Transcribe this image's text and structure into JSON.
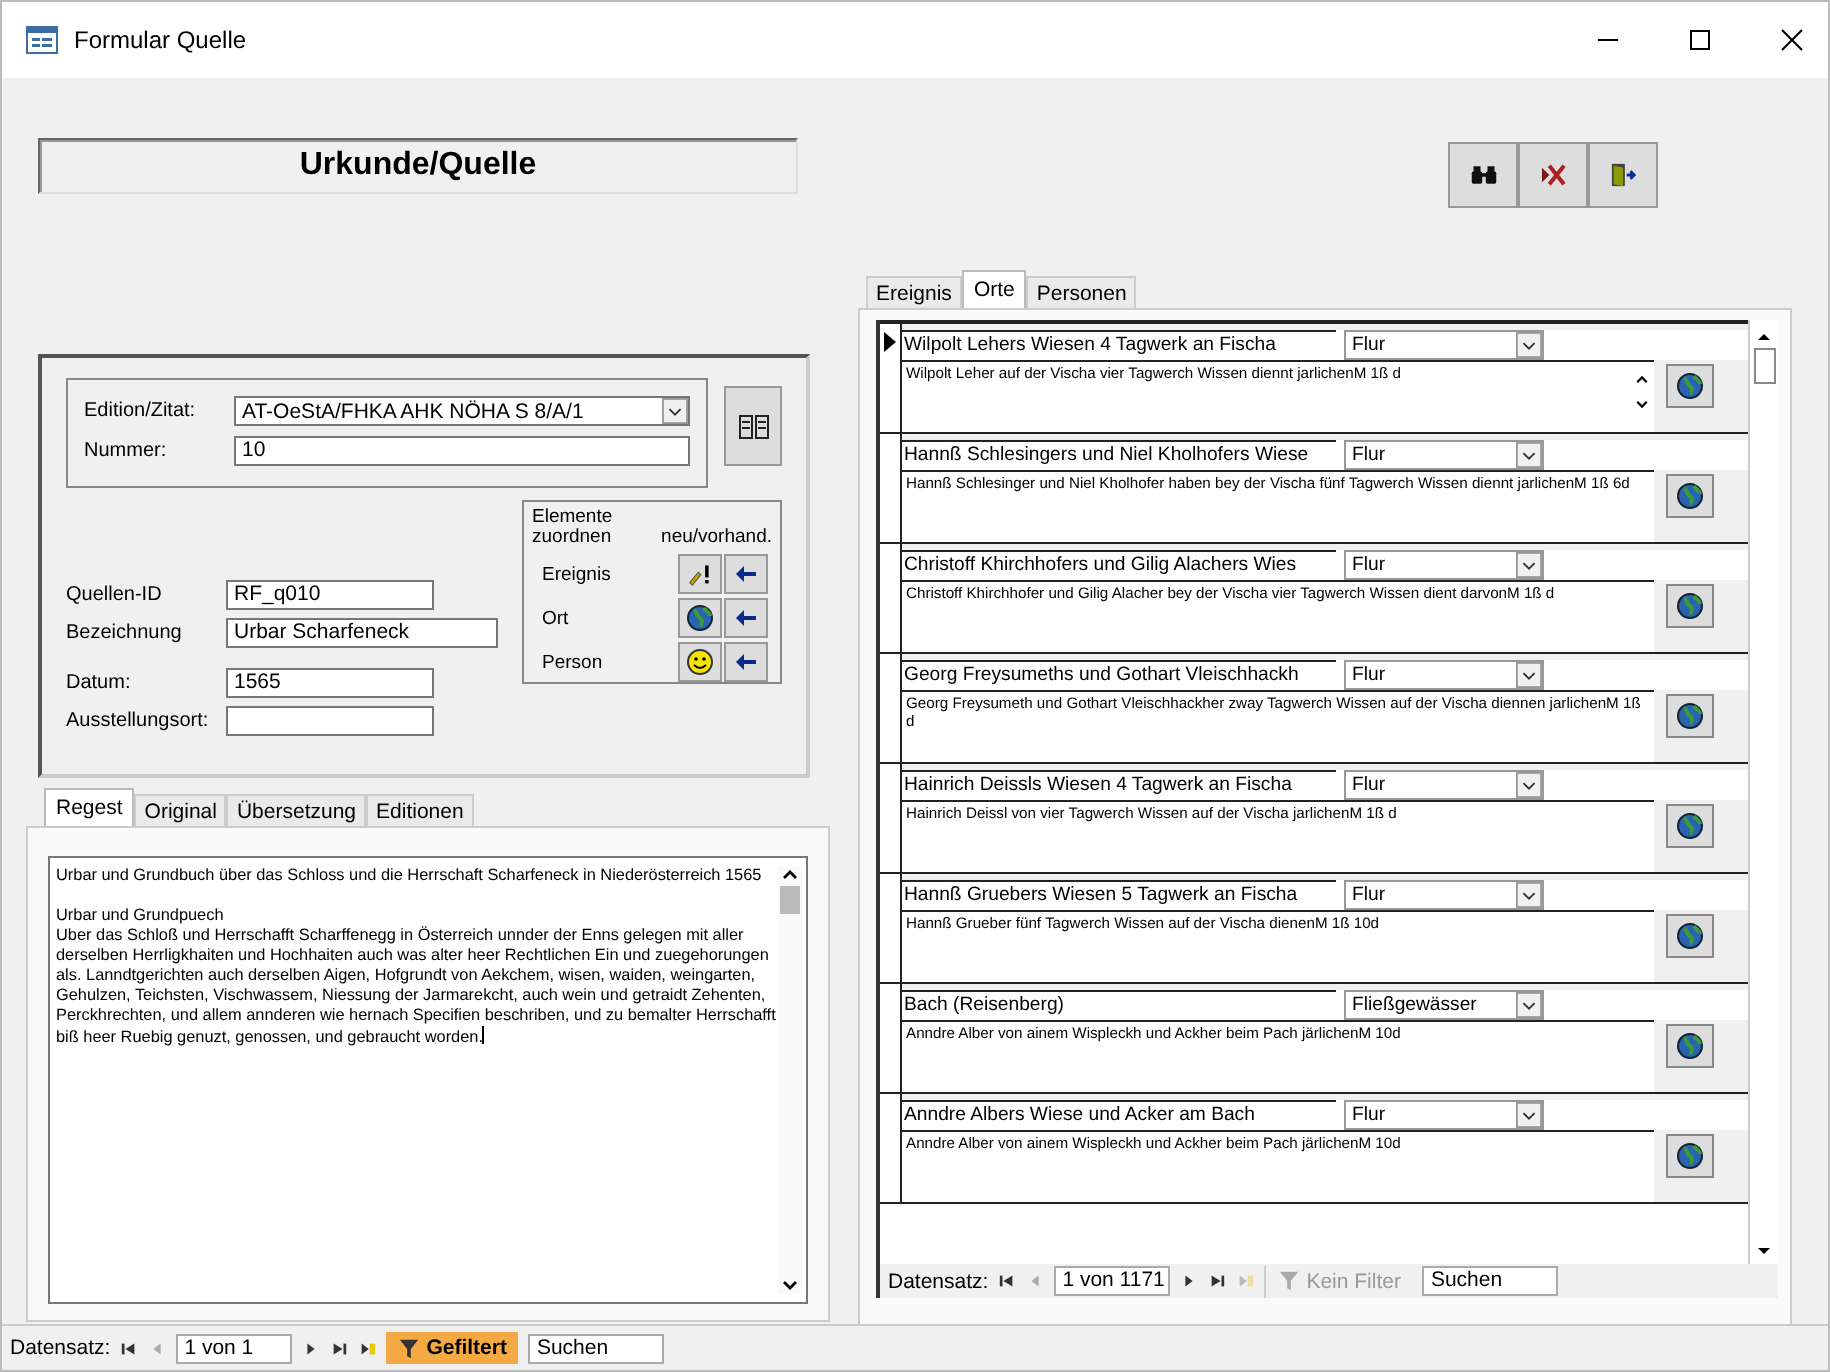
{
  "window": {
    "title": "Formular Quelle"
  },
  "heading": "Urkunde/Quelle",
  "edition": {
    "label": "Edition/Zitat:",
    "value": "AT-OeStA/FHKA AHK NÖHA S 8/A/1"
  },
  "nummer": {
    "label": "Nummer:",
    "value": "10"
  },
  "fields": [
    {
      "label": "Quellen-ID",
      "value": "RF_q010"
    },
    {
      "label": "Bezeichnung",
      "value": "Urbar Scharfeneck"
    },
    {
      "label": "Datum:",
      "value": "1565"
    },
    {
      "label": "Ausstellungsort:"
    }
  ],
  "elements": {
    "title": "Elemente zuordnen",
    "column": "neu/vorhand.",
    "rows": [
      {
        "label": "Ereignis",
        "kind": "event"
      },
      {
        "label": "Ort",
        "kind": "globe"
      },
      {
        "label": "Person",
        "kind": "smiley"
      }
    ]
  },
  "left_tabs": [
    {
      "label": "Regest",
      "selected": true
    },
    {
      "label": "Original",
      "selected": false
    },
    {
      "label": "Übersetzung",
      "selected": false
    },
    {
      "label": "Editionen",
      "selected": false
    }
  ],
  "regest": "Urbar und Grundbuch über das Schloss und die Herrschaft Scharfeneck in Niederösterreich 1565\n\nUrbar und Grundpuech\nUber das Schloß und Herrschafft Scharffenegg in Österreich unnder der Enns gelegen mit aller derselben Herrligkhaiten und Hochhaiten auch was alter heer Rechtlichen Ein und zuegehorungen als. Lanndtgerichten auch derselben Aigen, Hofgrundt von Aekchem, wisen, waiden, weingarten, Gehulzen, Teichsten, Vischwassem, Niessung der Jarmarekcht, auch wein und getraidt Zehenten, Perckhrechten, und allem annderen wie hernach Specifien beschriben, und zu bemalter Herrschafft biß heer Ruebig genuzt, genossen, und gebraucht worden.",
  "right_tabs": [
    {
      "label": "Ereignis",
      "selected": false
    },
    {
      "label": "Orte",
      "selected": true
    },
    {
      "label": "Personen",
      "selected": false
    }
  ],
  "places": [
    {
      "name": "Wilpolt Lehers Wiesen 4 Tagwerk an Fischa",
      "type": "Flur",
      "description": "Wilpolt Leher auf der Vischa vier Tagwerch Wissen diennt jarlichenM 1ß d",
      "current": true
    },
    {
      "name": "Hannß Schlesingers und Niel Kholhofers Wiese",
      "type": "Flur",
      "description": "Hannß Schlesinger und Niel Kholhofer haben bey der Vischa fünf Tagwerch Wissen diennt jarlichenM 1ß 6d",
      "current": false
    },
    {
      "name": "Christoff Khirchhofers und Gilig Alachers Wies",
      "type": "Flur",
      "description": "Christoff Khirchhofer und Gilig Alacher bey der Vischa vier Tagwerch Wissen dient darvonM 1ß d",
      "current": false
    },
    {
      "name": "Georg Freysumeths und Gothart Vleischhackh",
      "type": "Flur",
      "description": "Georg Freysumeth und Gothart Vleischhackher zway Tagwerch Wissen auf der Vischa diennen jarlichenM 1ß d",
      "current": false
    },
    {
      "name": "Hainrich Deissls Wiesen 4 Tagwerk an Fischa",
      "type": "Flur",
      "description": "Hainrich Deissl von vier Tagwerch Wissen auf der Vischa jarlichenM 1ß d",
      "current": false
    },
    {
      "name": "Hannß Gruebers Wiesen 5 Tagwerk an Fischa",
      "type": "Flur",
      "description": "Hannß Grueber fünf Tagwerch Wissen auf der Vischa dienenM 1ß 10d",
      "current": false
    },
    {
      "name": "Bach (Reisenberg)",
      "type": "Fließgewässer",
      "description": "Anndre Alber von ainem Wispleckh und Ackher beim Pach järlichenM 10d",
      "current": false
    },
    {
      "name": "Anndre Albers Wiese und Acker am Bach",
      "type": "Flur",
      "description": "Anndre Alber von ainem Wispleckh und Ackher beim Pach järlichenM 10d",
      "current": false
    }
  ],
  "subform_nav": {
    "label": "Datensatz:",
    "position": "1 von 1171",
    "filter": "Kein Filter",
    "filtered": false,
    "search": "Suchen"
  },
  "status_bar": {
    "label": "Datensatz:",
    "position": "1 von 1",
    "filter": "Gefiltert",
    "filtered": true,
    "search": "Suchen"
  }
}
